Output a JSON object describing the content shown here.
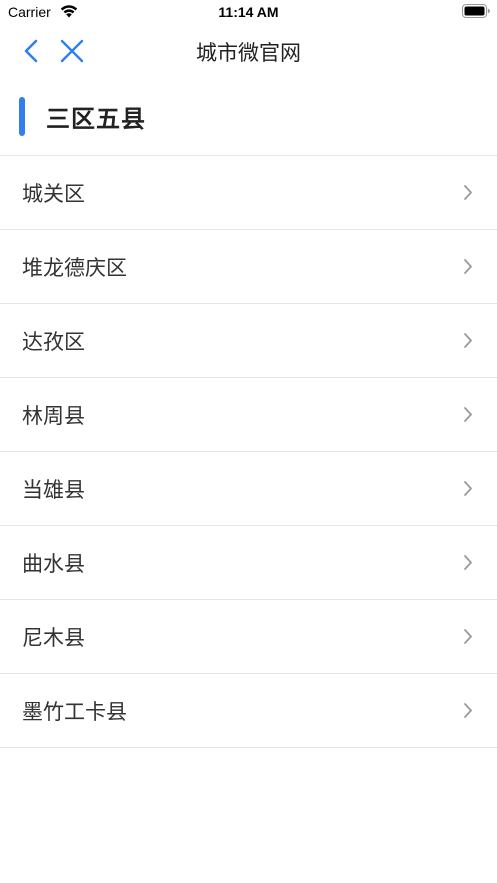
{
  "status_bar": {
    "carrier": "Carrier",
    "time": "11:14 AM"
  },
  "nav": {
    "title": "城市微官网",
    "accent_color": "#2f7ff0",
    "back_icon": "chevron-left-icon",
    "close_icon": "close-icon"
  },
  "section": {
    "title": "三区五县",
    "bar_color": "#2f7ff0"
  },
  "list": {
    "items": [
      {
        "label": "城关区"
      },
      {
        "label": "堆龙德庆区"
      },
      {
        "label": "达孜区"
      },
      {
        "label": "林周县"
      },
      {
        "label": "当雄县"
      },
      {
        "label": "曲水县"
      },
      {
        "label": "尼木县"
      },
      {
        "label": "墨竹工卡县"
      }
    ],
    "chevron_icon": "chevron-right-icon"
  }
}
